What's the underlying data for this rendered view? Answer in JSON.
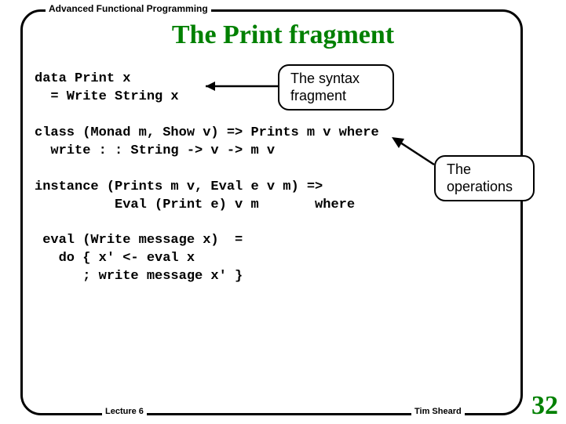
{
  "header": "Advanced Functional Programming",
  "title": "The Print fragment",
  "code": {
    "l1": "data Print x",
    "l2": "  = Write String x",
    "l3": "",
    "l4": "class (Monad m, Show v) => Prints m v where",
    "l5": "  write : : String -> v -> m v",
    "l6": "",
    "l7": "instance (Prints m v, Eval e v m) =>",
    "l8": "          Eval (Print e) v m       where",
    "l9": "",
    "l10": " eval (Write message x)  =",
    "l11": "   do { x' <- eval x",
    "l12": "      ; write message x' }"
  },
  "callouts": {
    "syntax_l1": "The syntax",
    "syntax_l2": "fragment",
    "ops_l1": "The",
    "ops_l2": "operations"
  },
  "footer": {
    "lecture": "Lecture 6",
    "author": "Tim Sheard",
    "page": "32"
  }
}
